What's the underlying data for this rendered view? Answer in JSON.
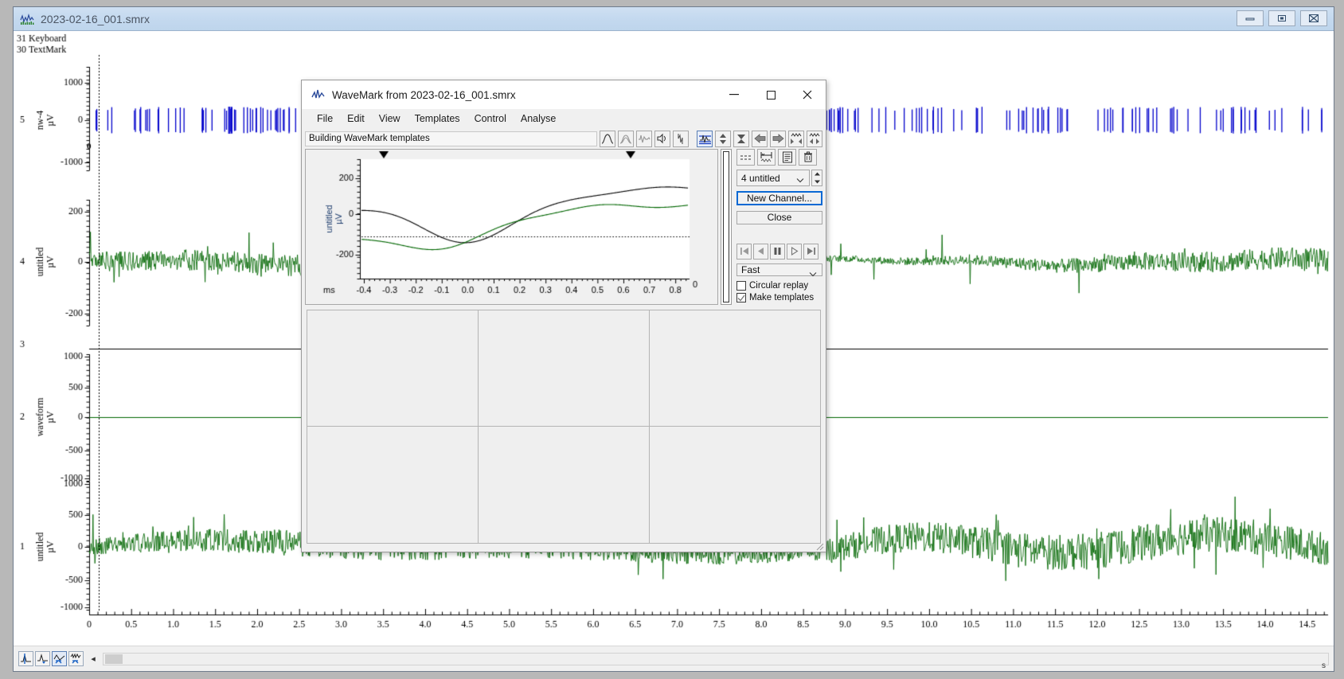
{
  "main_window": {
    "title": "2023-02-16_001.smrx",
    "icon": "waveform-icon",
    "window_buttons": {
      "minimize": "minimize-icon",
      "maximize": "maximize-icon",
      "close": "close-icon"
    },
    "x_axis": {
      "unit_label": "s",
      "ticks": [
        "0",
        "0.5",
        "1.0",
        "1.5",
        "2.0",
        "2.5",
        "3.0",
        "3.5",
        "4.0",
        "4.5",
        "5.0",
        "5.5",
        "6.0",
        "6.5",
        "7.0",
        "7.5",
        "8.0",
        "8.5",
        "9.0",
        "9.5",
        "10.0",
        "10.5",
        "11.0",
        "11.5",
        "12.0",
        "12.5",
        "13.0",
        "13.5",
        "14.0",
        "14.5"
      ],
      "min": 0,
      "max": 14.75
    },
    "channels": [
      {
        "number": "31",
        "name": "Keyboard",
        "units": "",
        "type": "marker"
      },
      {
        "number": "30",
        "name": "TextMark",
        "units": "",
        "type": "marker"
      },
      {
        "number": "5",
        "name": "nw-4",
        "units": "µV",
        "type": "wavemark",
        "y_ticks": [
          "1000",
          "0",
          "-1000"
        ],
        "zero_label": "0",
        "color": "#0000cc"
      },
      {
        "number": "4",
        "name": "untitled",
        "units": "µV",
        "type": "waveform",
        "y_ticks": [
          "200",
          "0",
          "-200"
        ],
        "color": "#006600"
      },
      {
        "number": "3",
        "name": "",
        "units": "",
        "type": "event",
        "color": "#000000"
      },
      {
        "number": "2",
        "name": "waveform",
        "units": "µV",
        "type": "waveform",
        "y_ticks": [
          "1000",
          "500",
          "0",
          "-500",
          "-1000"
        ],
        "color": "#006600"
      },
      {
        "number": "1",
        "name": "untitled",
        "units": "µV",
        "type": "waveform",
        "y_ticks": [
          "1000",
          "500",
          "0",
          "-500",
          "-1000"
        ],
        "color": "#006600"
      }
    ],
    "bottom_toolbar": [
      {
        "icon": "cursor-tool-icon",
        "selected": false
      },
      {
        "icon": "add-cursor-icon",
        "selected": false
      },
      {
        "icon": "measure-icon",
        "selected": true
      },
      {
        "icon": "spike-shape-icon",
        "selected": false
      }
    ],
    "scrollbar": {
      "left_arrow": "chevron-left-icon"
    }
  },
  "dialog": {
    "title": "WaveMark from 2023-02-16_001.smrx",
    "icon": "waveform-icon",
    "window_buttons": {
      "minimize": "–",
      "maximize": "□",
      "close": "✕"
    },
    "menu": [
      "File",
      "Edit",
      "View",
      "Templates",
      "Control",
      "Analyse"
    ],
    "status_text": "Building WaveMark templates",
    "toolbar_left": [
      {
        "icon": "single-template-icon",
        "selected": false
      },
      {
        "icon": "overdraw-template-icon",
        "selected": false
      },
      {
        "icon": "raw-trace-icon",
        "selected": false
      },
      {
        "icon": "sound-icon",
        "selected": false
      },
      {
        "icon": "spike-trace-icon",
        "selected": false
      }
    ],
    "toolbar_right": [
      {
        "icon": "trigger-levels-icon",
        "selected": true
      },
      {
        "icon": "vertical-scale-icon",
        "selected": false
      },
      {
        "icon": "hourglass-icon",
        "selected": false
      },
      {
        "icon": "arrow-left-icon",
        "selected": false
      },
      {
        "icon": "arrow-right-icon",
        "selected": false
      },
      {
        "icon": "collapse-in-icon",
        "selected": false
      },
      {
        "icon": "expand-out-icon",
        "selected": false
      }
    ],
    "plot": {
      "y_label": "untitled",
      "y_units": "µV",
      "y_ticks": [
        "200",
        "0",
        "-200"
      ],
      "x_label": "ms",
      "x_ticks": [
        "-0.4",
        "-0.3",
        "-0.2",
        "-0.1",
        "0.0",
        "0.1",
        "0.2",
        "0.3",
        "0.4",
        "0.5",
        "0.6",
        "0.7",
        "0.8"
      ],
      "right_edge_label": "0",
      "trace_colors": {
        "primary": "#000000",
        "secondary": "#006600"
      },
      "markers": [
        "cursor-marker-left",
        "cursor-marker-right"
      ]
    },
    "side_panel": {
      "icon_buttons": [
        {
          "icon": "dashed-lines-icon"
        },
        {
          "icon": "template-width-icon"
        },
        {
          "icon": "template-list-icon"
        },
        {
          "icon": "delete-icon"
        }
      ],
      "channel_select": {
        "value": "4 untitled",
        "chevron": "chevron-down-icon",
        "spinner": "spinner-icon"
      },
      "new_channel_button": "New Channel...",
      "close_button": "Close",
      "playback": [
        {
          "icon": "skip-start-icon"
        },
        {
          "icon": "step-back-icon"
        },
        {
          "icon": "pause-icon"
        },
        {
          "icon": "play-icon"
        },
        {
          "icon": "skip-end-icon"
        }
      ],
      "speed_select": {
        "value": "Fast",
        "chevron": "chevron-down-icon"
      },
      "circular_replay": {
        "label": "Circular replay",
        "checked": false
      },
      "make_templates": {
        "label": "Make templates",
        "checked": true
      }
    },
    "template_grid": {
      "rows": 2,
      "cols": 3
    }
  },
  "colors": {
    "waveform_green": "#006600",
    "wavemark_blue": "#0000cc",
    "event_black": "#000000",
    "accent_blue": "#0a69d4",
    "titlebar_blue": "#c4d9ef"
  }
}
